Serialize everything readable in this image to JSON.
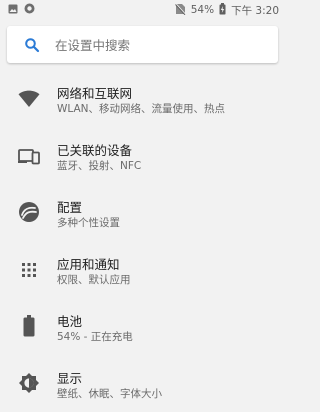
{
  "status_bar": {
    "left_icons": [
      "image-icon",
      "record-icon"
    ],
    "battery_percent": "54%",
    "time": "下午 3:20"
  },
  "search": {
    "placeholder": "在设置中搜索",
    "icon": "search-icon",
    "accent": "#2b7bd6"
  },
  "items": [
    {
      "title": "网络和互联网",
      "subtitle": "WLAN、移动网络、流量使用、热点",
      "icon": "wifi-icon"
    },
    {
      "title": "已关联的设备",
      "subtitle": "蓝牙、投射、NFC",
      "icon": "devices-icon"
    },
    {
      "title": "配置",
      "subtitle": "多种个性设置",
      "icon": "configure-icon"
    },
    {
      "title": "应用和通知",
      "subtitle": "权限、默认应用",
      "icon": "apps-grid-icon"
    },
    {
      "title": "电池",
      "subtitle": "54% - 正在充电",
      "icon": "battery-icon"
    },
    {
      "title": "显示",
      "subtitle": "壁纸、休眠、字体大小",
      "icon": "brightness-icon"
    }
  ]
}
